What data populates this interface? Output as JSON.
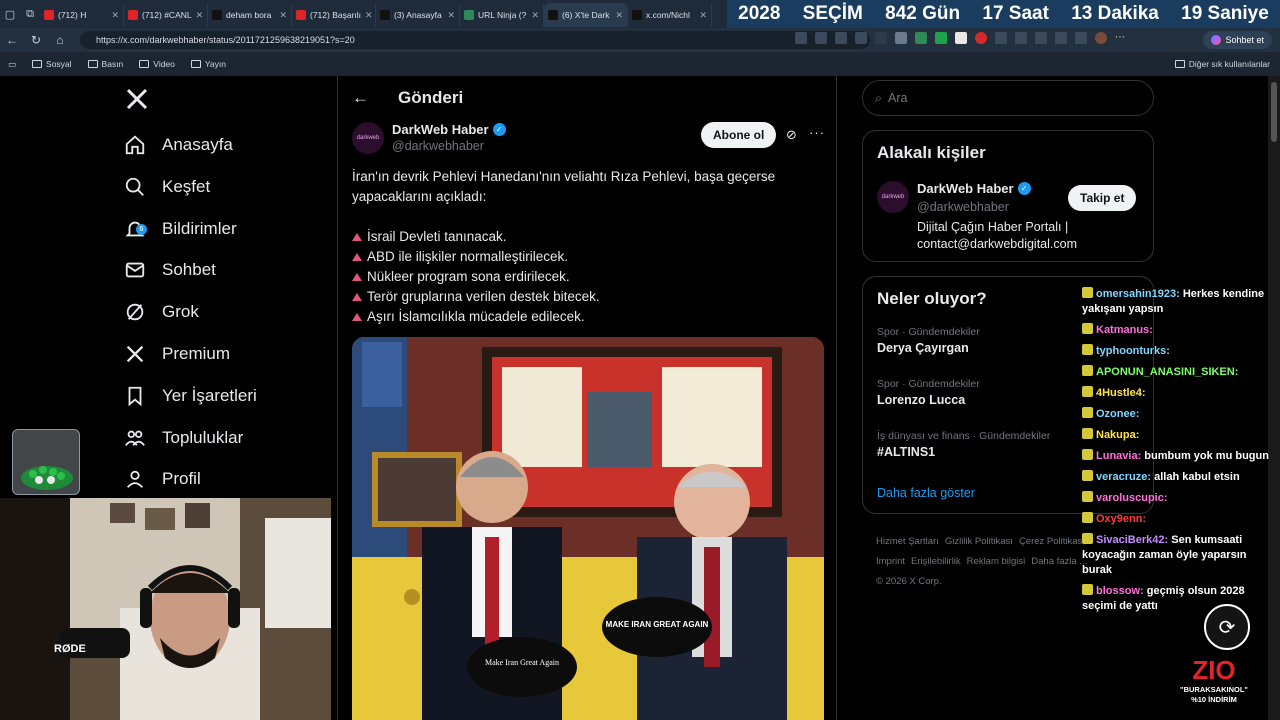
{
  "browser": {
    "tabs": [
      {
        "label": "(712) H",
        "color": "#e0242a"
      },
      {
        "label": "(712) #CANL",
        "color": "#e0242a"
      },
      {
        "label": "deham bora",
        "color": "#111111"
      },
      {
        "label": "(712) Başarılı",
        "color": "#e0242a"
      },
      {
        "label": "(3) Anasayfa",
        "color": "#111111"
      },
      {
        "label": "URL Ninja (?",
        "color": "#2e8b57"
      },
      {
        "label": "(6) X'te Dark",
        "color": "#111111"
      },
      {
        "label": "x.com/Nichl",
        "color": "#111111"
      }
    ],
    "url": "https://x.com/darkwebhaber/status/2011721259638219051?s=20",
    "sohbet_label": "Sohbet et",
    "bookmarks": [
      "Sosyal",
      "Basın",
      "Video",
      "Yayın"
    ],
    "other_bookmarks": "Diğer sık kullanılanlar"
  },
  "countdown": {
    "year": "2028",
    "label": "SEÇİM",
    "days": "842 Gün",
    "hours": "17 Saat",
    "minutes": "13 Dakika",
    "seconds": "19 Saniye"
  },
  "nav": {
    "items": [
      {
        "label": "Anasayfa",
        "icon": "home-icon"
      },
      {
        "label": "Keşfet",
        "icon": "search-icon"
      },
      {
        "label": "Bildirimler",
        "icon": "bell-icon",
        "badge": "6"
      },
      {
        "label": "Sohbet",
        "icon": "mail-icon"
      },
      {
        "label": "Grok",
        "icon": "grok-icon"
      },
      {
        "label": "Premium",
        "icon": "x-icon"
      },
      {
        "label": "Yer İşaretleri",
        "icon": "bookmark-icon"
      },
      {
        "label": "Topluluklar",
        "icon": "communities-icon"
      },
      {
        "label": "Profil",
        "icon": "profile-icon"
      }
    ]
  },
  "post": {
    "header": "Gönderi",
    "author_name": "DarkWeb Haber",
    "author_handle": "@darkwebhaber",
    "avatar_text": "darkweb",
    "subscribe_label": "Abone ol",
    "text_intro": "İran'ın devrik Pehlevi Hanedanı'nın veliahtı Rıza Pehlevi, başa geçerse yapacaklarını açıkladı:",
    "bullets": [
      "İsrail Devleti tanınacak.",
      "ABD ile ilişkiler normalleştirilecek.",
      "Nükleer program sona erdirilecek.",
      "Terör gruplarına verilen destek bitecek.",
      "Aşırı İslamcılıkla mücadele edilecek."
    ],
    "cap_left": "Make Iran Great Again",
    "cap_right": "MAKE IRAN GREAT AGAIN"
  },
  "sidebar": {
    "search_placeholder": "Ara",
    "related_title": "Alakalı kişiler",
    "related": {
      "name": "DarkWeb Haber",
      "handle": "@darkwebhaber",
      "bio": "Dijital Çağın Haber Portalı | contact@darkwebdigital.com",
      "follow_label": "Takip et",
      "avatar_text": "darkweb"
    },
    "trends_title": "Neler oluyor?",
    "trends": [
      {
        "category": "Spor · Gündemdekiler",
        "name": "Derya Çayırgan"
      },
      {
        "category": "Spor · Gündemdekiler",
        "name": "Lorenzo Lucca"
      },
      {
        "category": "İş dünyası ve finans · Gündemdekiler",
        "name": "#ALTINS1"
      }
    ],
    "show_more": "Daha fazla göster",
    "footer": [
      "Hizmet Şartları",
      "Gizlilik Politikası",
      "Çerez Politikası",
      "Imprint",
      "Erişilebilirlik",
      "Reklam bilgisi",
      "Daha fazla ...",
      "© 2026 X Corp."
    ]
  },
  "chat": [
    {
      "user": "omersahin1923:",
      "text": "Herkes kendine yakışanı yapsın",
      "color": "#7fd6ff"
    },
    {
      "user": "Katmanus:",
      "text": "",
      "color": "#ff6fd8"
    },
    {
      "user": "typhoonturks:",
      "text": "",
      "color": "#7fd6ff"
    },
    {
      "user": "APONUN_ANASINI_SIKEN:",
      "text": "",
      "color": "#7cff6b"
    },
    {
      "user": "4Hustle4:",
      "text": "",
      "color": "#ffe34d"
    },
    {
      "user": "Ozonee:",
      "text": "",
      "color": "#7fd6ff"
    },
    {
      "user": "Nakupa:",
      "text": "",
      "color": "#ffe34d"
    },
    {
      "user": "Lunavia:",
      "text": "bumbum yok mu bugun",
      "color": "#ff6fd8"
    },
    {
      "user": "veracruze:",
      "text": "allah kabul etsin",
      "color": "#7fd6ff"
    },
    {
      "user": "varoluscupic:",
      "text": "",
      "color": "#ff6fd8"
    },
    {
      "user": "Oxy9enn:",
      "text": "",
      "color": "#ff3b3b"
    },
    {
      "user": "SivaciBerk42:",
      "text": "Sen kumsaati koyacağın zaman öyle yaparsın burak",
      "color": "#c38bff"
    },
    {
      "user": "blossow:",
      "text": "geçmiş olsun 2028 seçimi de yattı",
      "color": "#ff6fd8"
    }
  ],
  "overlay": {
    "brand": "ZIO",
    "promo_code": "\"BURAKSAKINOL\"",
    "promo_text": "%10 İNDİRİM",
    "webcam_label": "RØDE"
  }
}
